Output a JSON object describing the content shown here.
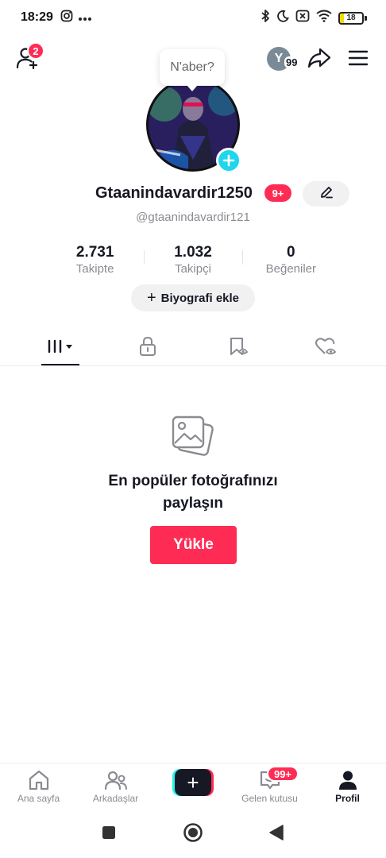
{
  "status_bar": {
    "time": "18:29",
    "battery_level": "18",
    "battery_fraction": 0.18,
    "icons": [
      "instagram-icon",
      "more-dots-icon",
      "bluetooth-icon",
      "moon-icon",
      "no-sim-icon",
      "wifi-icon",
      "battery-icon"
    ]
  },
  "header": {
    "add_friends_badge": "2",
    "account_initial": "Y",
    "account_count": "99"
  },
  "profile": {
    "bubble_text": "N'aber?",
    "display_name": "Gtaanindavardir1250",
    "name_badge": "9+",
    "handle": "@gtaanindavardir121",
    "stats": [
      {
        "value": "2.731",
        "label": "Takipte"
      },
      {
        "value": "1.032",
        "label": "Takipçi"
      },
      {
        "value": "0",
        "label": "Beğeniler"
      }
    ],
    "bio_button": "Biyografi ekle",
    "bio_plus": "+"
  },
  "tabs": [
    {
      "icon": "videos-grid-icon",
      "active": true
    },
    {
      "icon": "lock-icon",
      "active": false
    },
    {
      "icon": "bookmark-icon",
      "active": false
    },
    {
      "icon": "liked-heart-icon",
      "active": false
    }
  ],
  "empty_state": {
    "icon": "photos-icon",
    "title_line1": "En popüler fotoğrafınızı",
    "title_line2": "paylaşın",
    "button": "Yükle"
  },
  "bottom_nav": {
    "items": [
      {
        "label": "Ana sayfa",
        "icon": "home-icon"
      },
      {
        "label": "Arkadaşlar",
        "icon": "friends-icon"
      },
      {
        "label": "+",
        "icon": "create-icon"
      },
      {
        "label": "Gelen kutusu",
        "icon": "inbox-icon"
      },
      {
        "label": "Profil",
        "icon": "profile-icon"
      }
    ],
    "inbox_badge": "99+"
  },
  "colors": {
    "accent": "#fe2c55",
    "cyan": "#25f4ee",
    "text_primary": "#161823",
    "text_secondary": "#8a8b91"
  }
}
